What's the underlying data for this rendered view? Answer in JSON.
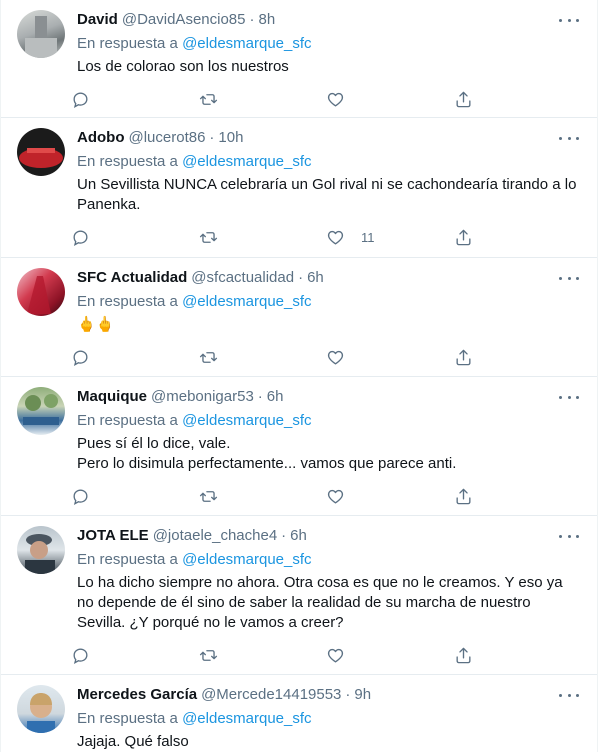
{
  "reply_prefix": "En respuesta a",
  "colors": {
    "link": "#1b95e0",
    "muted": "#5b7083",
    "text": "#0f1419",
    "divider": "#e6ecf0"
  },
  "icons": [
    "reply-icon",
    "retweet-icon",
    "like-icon",
    "share-icon",
    "more-icon"
  ],
  "tweets": [
    {
      "name": "David",
      "handle": "@DavidAsencio85",
      "time": "8h",
      "reply_to": "@eldesmarque_sfc",
      "text": "Los de colorao son los nuestros",
      "likes": ""
    },
    {
      "name": "Adobo",
      "handle": "@lucerot86",
      "time": "10h",
      "reply_to": "@eldesmarque_sfc",
      "text": "Un Sevillista NUNCA celebraría un Gol rival ni se cachondearía tirando a lo Panenka.",
      "likes": "11"
    },
    {
      "name": "SFC Actualidad",
      "handle": "@sfcactualidad",
      "time": "6h",
      "reply_to": "@eldesmarque_sfc",
      "text": "🖕🖕",
      "likes": ""
    },
    {
      "name": "Maquique",
      "handle": "@mebonigar53",
      "time": "6h",
      "reply_to": "@eldesmarque_sfc",
      "text": "Pues sí él lo dice, vale.\nPero lo disimula perfectamente... vamos que parece anti.",
      "likes": ""
    },
    {
      "name": "JOTA ELE",
      "handle": "@jotaele_chache4",
      "time": "6h",
      "reply_to": "@eldesmarque_sfc",
      "text": "Lo ha dicho siempre no ahora. Otra cosa es que no le creamos. Y eso ya no depende de él sino de saber la realidad de su marcha de nuestro Sevilla. ¿Y porqué no le vamos a creer?",
      "likes": ""
    },
    {
      "name": "Mercedes García",
      "handle": "@Mercede14419553",
      "time": "9h",
      "reply_to": "@eldesmarque_sfc",
      "text": "Jajaja. Qué falso",
      "likes": ""
    }
  ]
}
